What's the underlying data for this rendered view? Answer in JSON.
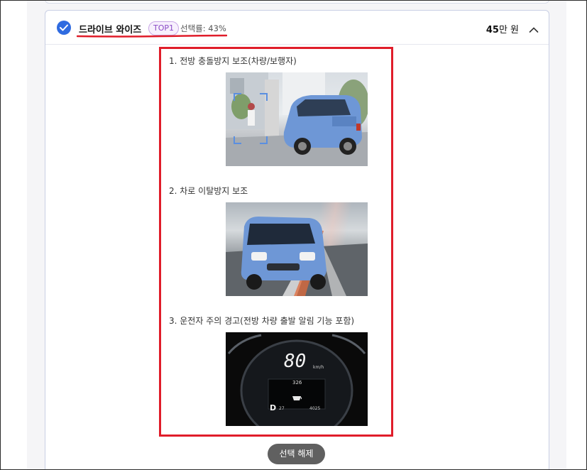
{
  "option": {
    "name": "드라이브 와이즈",
    "badge": "TOP1",
    "selection_rate": "선택률: 43%",
    "price_number": "45",
    "price_unit": "만 원"
  },
  "features": [
    {
      "label": "1. 전방 충돌방지 보조(차량/보행자)"
    },
    {
      "label": "2. 차로 이탈방지 보조"
    },
    {
      "label": "3. 운전자 주의 경고(전방 차량 출발 알림 기능 포함)"
    }
  ],
  "dashboard": {
    "speed": "80",
    "speed_unit": "km/h",
    "range": "326",
    "gear": "D",
    "temp": "27",
    "odometer": "4025"
  },
  "deselect_label": "선택 해제",
  "colors": {
    "accent": "#2f6be0",
    "highlight_red": "#e01d2a",
    "badge_purple": "#8a4bc6",
    "car_blue": "#6e97d6"
  }
}
